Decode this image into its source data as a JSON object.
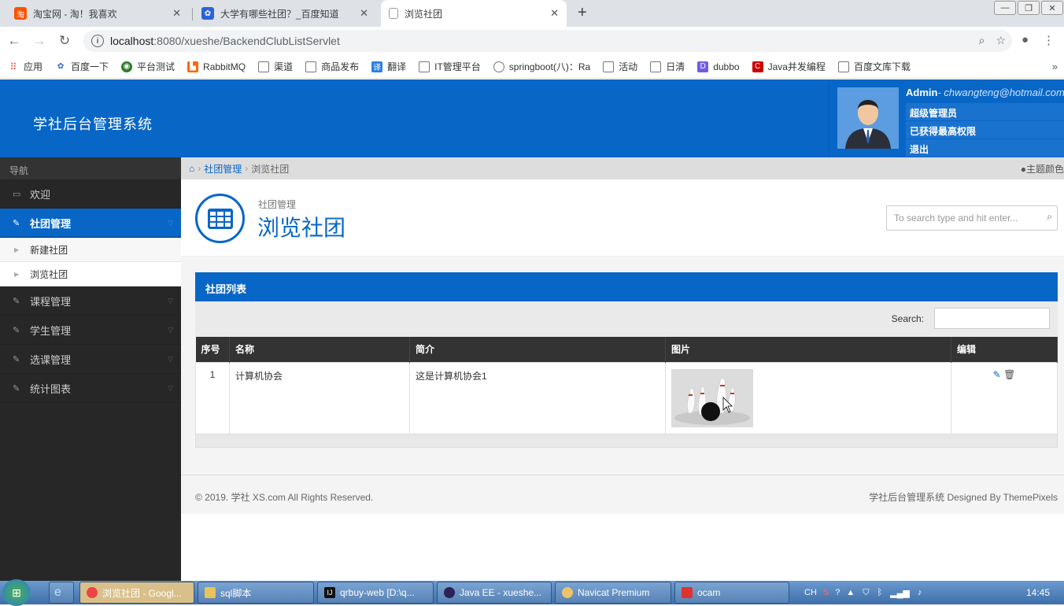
{
  "browser": {
    "tabs": [
      {
        "title": "淘宝网 - 淘！我喜欢",
        "favicon": "taobao-icon"
      },
      {
        "title": "大学有哪些社团？_百度知道",
        "favicon": "baidu-paw-icon"
      },
      {
        "title": "浏览社团",
        "favicon": "page-icon",
        "active": true
      }
    ],
    "url_host": "localhost",
    "url_path": ":8080/xueshe/BackendClubListServlet",
    "bookmarks": [
      "应用",
      "百度一下",
      "平台测试",
      "RabbitMQ",
      "渠道",
      "商品发布",
      "翻译",
      "IT管理平台",
      "springboot(八)：Ra",
      "活动",
      "日清",
      "dubbo",
      "Java并发编程",
      "百度文库下载"
    ]
  },
  "header": {
    "brand": "学社后台管理系统",
    "user_name": "Admin",
    "user_email": "- chwangteng@hotmail.com",
    "menu": [
      "超级管理员",
      "已获得最高权限",
      "退出"
    ]
  },
  "sidebar": {
    "header": "导航",
    "items": [
      {
        "label": "欢迎",
        "icon": "laptop-icon"
      },
      {
        "label": "社团管理",
        "icon": "pencil-icon",
        "active": true
      },
      {
        "label": "新建社团",
        "sub": true
      },
      {
        "label": "浏览社团",
        "sub": true,
        "current": true
      },
      {
        "label": "课程管理",
        "icon": "pencil-icon"
      },
      {
        "label": "学生管理",
        "icon": "pencil-icon"
      },
      {
        "label": "选课管理",
        "icon": "pencil-icon"
      },
      {
        "label": "统计图表",
        "icon": "pencil-icon"
      }
    ]
  },
  "breadcrumb": {
    "section": "社团管理",
    "current": "浏览社团",
    "theme": "主题颜色"
  },
  "page": {
    "pretitle": "社团管理",
    "title": "浏览社团",
    "search_placeholder": "To search type and hit enter..."
  },
  "widget": {
    "title": "社团列表",
    "search_label": "Search:",
    "columns": [
      "序号",
      "名称",
      "简介",
      "图片",
      "编辑"
    ],
    "rows": [
      {
        "no": "1",
        "name": "计算机协会",
        "intro": "这是计算机协会1",
        "image": "bowling-image"
      }
    ]
  },
  "footer": {
    "left": "© 2019. 学社 XS.com All Rights Reserved.",
    "right": "学社后台管理系统  Designed By ThemePixels"
  },
  "taskbar": {
    "buttons": [
      "浏览社团 - Googl...",
      "sql脚本",
      "qrbuy-web [D:\\q...",
      "Java EE - xueshe...",
      "Navicat Premium",
      "ocam"
    ],
    "tray_lang": "CH",
    "clock": "14:45"
  },
  "colors": {
    "brand": "#0866c6",
    "sidebar": "#272727"
  }
}
